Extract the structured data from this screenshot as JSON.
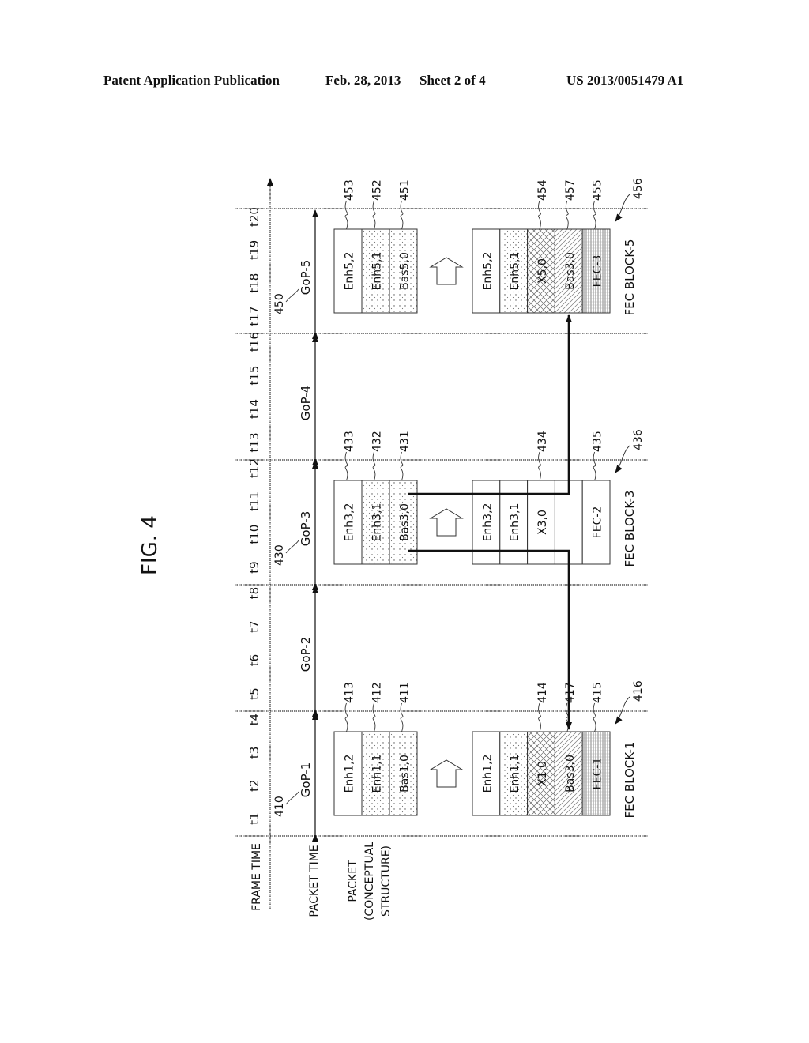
{
  "header": {
    "publication": "Patent Application Publication",
    "date": "Feb. 28, 2013",
    "sheet": "Sheet 2 of 4",
    "patent_number": "US 2013/0051479 A1"
  },
  "figure": {
    "title": "FIG. 4",
    "row_labels": {
      "frame_time": "FRAME TIME",
      "packet_time": "PACKET TIME",
      "packet_line1": "PACKET",
      "packet_line2": "(CONCEPTUAL",
      "packet_line3": "STRUCTURE)"
    },
    "gops": [
      {
        "name": "GoP-1",
        "ref": "410",
        "frame_times": [
          "t1",
          "t2",
          "t3",
          "t4"
        ],
        "packet": [
          {
            "label": "Enh1,2",
            "ref": "413",
            "fill": "plain"
          },
          {
            "label": "Enh1,1",
            "ref": "412",
            "fill": "dots"
          },
          {
            "label": "Bas1,0",
            "ref": "411",
            "fill": "dots"
          }
        ],
        "fec_block": {
          "name": "FEC BLOCK-1",
          "ref": "416",
          "cells": [
            {
              "label": "Enh1,2",
              "ref": "",
              "fill": "plain"
            },
            {
              "label": "Enh1,1",
              "ref": "",
              "fill": "dots"
            },
            {
              "label": "X1,0",
              "ref": "414",
              "fill": "cross"
            },
            {
              "label": "Bas3,0",
              "ref": "417",
              "fill": "diag"
            },
            {
              "label": "FEC-1",
              "ref": "415",
              "fill": "vlines"
            }
          ]
        }
      },
      {
        "name": "GoP-2",
        "ref": "",
        "frame_times": [
          "t5",
          "t6",
          "t7",
          "t8"
        ],
        "packet": [],
        "fec_block": null
      },
      {
        "name": "GoP-3",
        "ref": "430",
        "frame_times": [
          "t9",
          "t10",
          "t11",
          "t12"
        ],
        "packet": [
          {
            "label": "Enh3,2",
            "ref": "433",
            "fill": "plain"
          },
          {
            "label": "Enh3,1",
            "ref": "432",
            "fill": "dots"
          },
          {
            "label": "Bas3,0",
            "ref": "431",
            "fill": "dots"
          }
        ],
        "fec_block": {
          "name": "FEC BLOCK-3",
          "ref": "436",
          "cells": [
            {
              "label": "Enh3,2",
              "ref": "",
              "fill": "plain"
            },
            {
              "label": "Enh3,1",
              "ref": "",
              "fill": "plain"
            },
            {
              "label": "X3,0",
              "ref": "434",
              "fill": "plain"
            },
            {
              "label": "",
              "ref": "",
              "fill": "plain"
            },
            {
              "label": "FEC-2",
              "ref": "435",
              "fill": "plain"
            }
          ]
        }
      },
      {
        "name": "GoP-4",
        "ref": "",
        "frame_times": [
          "t13",
          "t14",
          "t15",
          "t16"
        ],
        "packet": [],
        "fec_block": null
      },
      {
        "name": "GoP-5",
        "ref": "450",
        "frame_times": [
          "t17",
          "t18",
          "t19",
          "t20"
        ],
        "packet": [
          {
            "label": "Enh5,2",
            "ref": "453",
            "fill": "plain"
          },
          {
            "label": "Enh5,1",
            "ref": "452",
            "fill": "dots"
          },
          {
            "label": "Bas5,0",
            "ref": "451",
            "fill": "dots"
          }
        ],
        "fec_block": {
          "name": "FEC BLOCK-5",
          "ref": "456",
          "cells": [
            {
              "label": "Enh5,2",
              "ref": "",
              "fill": "plain"
            },
            {
              "label": "Enh5,1",
              "ref": "",
              "fill": "dots"
            },
            {
              "label": "X5,0",
              "ref": "454",
              "fill": "cross"
            },
            {
              "label": "Bas3,0",
              "ref": "457",
              "fill": "diag"
            },
            {
              "label": "FEC-3",
              "ref": "455",
              "fill": "vlines"
            }
          ]
        }
      }
    ],
    "connections": [
      {
        "from": "Bas3,0 (431)",
        "to": "Bas3,0 (457) in FEC BLOCK-5"
      },
      {
        "from": "Bas3,0 (431)",
        "to": "Bas3,0 (417) in FEC BLOCK-1"
      }
    ]
  }
}
